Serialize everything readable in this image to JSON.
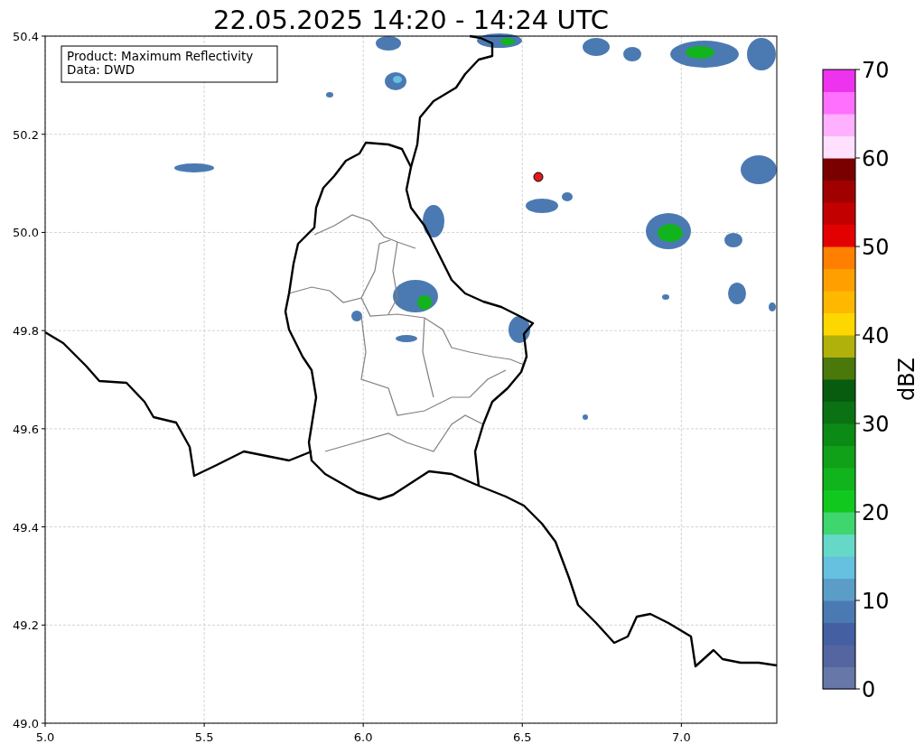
{
  "title": "22.05.2025 14:20 - 14:24 UTC",
  "info_box": {
    "lines": [
      "Product: Maximum Reflectivity",
      "Data: DWD"
    ]
  },
  "x_axis": {
    "ticks": [
      "5.0",
      "5.5",
      "6.0",
      "6.5",
      "7.0"
    ]
  },
  "y_axis": {
    "ticks": [
      "50.4",
      "50.2",
      "50.0",
      "49.8",
      "49.6",
      "49.4",
      "49.2",
      "49.0"
    ]
  },
  "colorbar": {
    "label": "dBZ",
    "ticks": [
      "70",
      "60",
      "50",
      "40",
      "30",
      "20",
      "10",
      "0"
    ],
    "bands": [
      {
        "color": "#6677a8"
      },
      {
        "color": "#5565a0"
      },
      {
        "color": "#4560a2"
      },
      {
        "color": "#4b7ab2"
      },
      {
        "color": "#5a9ec8"
      },
      {
        "color": "#66c0e0"
      },
      {
        "color": "#66d8c8"
      },
      {
        "color": "#3fd56f"
      },
      {
        "color": "#11c81f"
      },
      {
        "color": "#11b41c"
      },
      {
        "color": "#10a118"
      },
      {
        "color": "#0c8a16"
      },
      {
        "color": "#0b7214"
      },
      {
        "color": "#075c10"
      },
      {
        "color": "#4a780a"
      },
      {
        "color": "#b0b10a"
      },
      {
        "color": "#ffd700"
      },
      {
        "color": "#ffb800"
      },
      {
        "color": "#ff9f00"
      },
      {
        "color": "#ff7f00"
      },
      {
        "color": "#e30000"
      },
      {
        "color": "#c20000"
      },
      {
        "color": "#a10000"
      },
      {
        "color": "#7a0000"
      },
      {
        "color": "#ffe0ff"
      },
      {
        "color": "#ffb0ff"
      },
      {
        "color": "#ff70ff"
      },
      {
        "color": "#ee33ee"
      }
    ]
  }
}
